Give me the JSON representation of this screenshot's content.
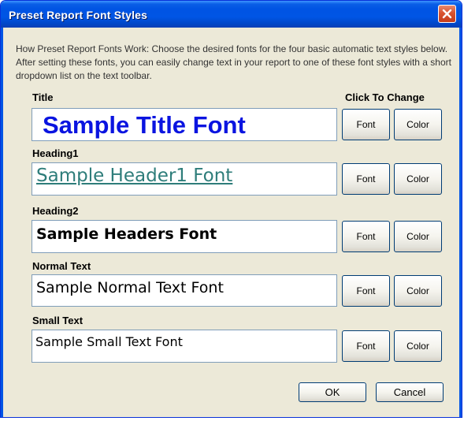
{
  "window": {
    "title": "Preset Report Font Styles"
  },
  "intro_text": "How Preset Report Fonts Work: Choose the desired fonts for the four basic automatic text styles below.  After setting these fonts, you can easily change text in your report to one of these font styles with a short dropdown list on the text toolbar.",
  "column_header": "Click To Change",
  "rows": [
    {
      "label": "Title",
      "sample": "Sample Title Font",
      "font_button": "Font",
      "color_button": "Color"
    },
    {
      "label": "Heading1",
      "sample": "Sample Header1 Font",
      "font_button": "Font",
      "color_button": "Color"
    },
    {
      "label": "Heading2",
      "sample": "Sample Headers Font",
      "font_button": "Font",
      "color_button": "Color"
    },
    {
      "label": "Normal Text",
      "sample": "Sample Normal Text Font",
      "font_button": "Font",
      "color_button": "Color"
    },
    {
      "label": "Small Text",
      "sample": "Sample Small Text Font",
      "font_button": "Font",
      "color_button": "Color"
    }
  ],
  "buttons": {
    "ok": "OK",
    "cancel": "Cancel"
  },
  "colors": {
    "title_sample": "#0a14e0",
    "heading1_sample": "#2e7d7a",
    "titlebar": "#0055e5",
    "dialog_bg": "#ece9d8"
  }
}
